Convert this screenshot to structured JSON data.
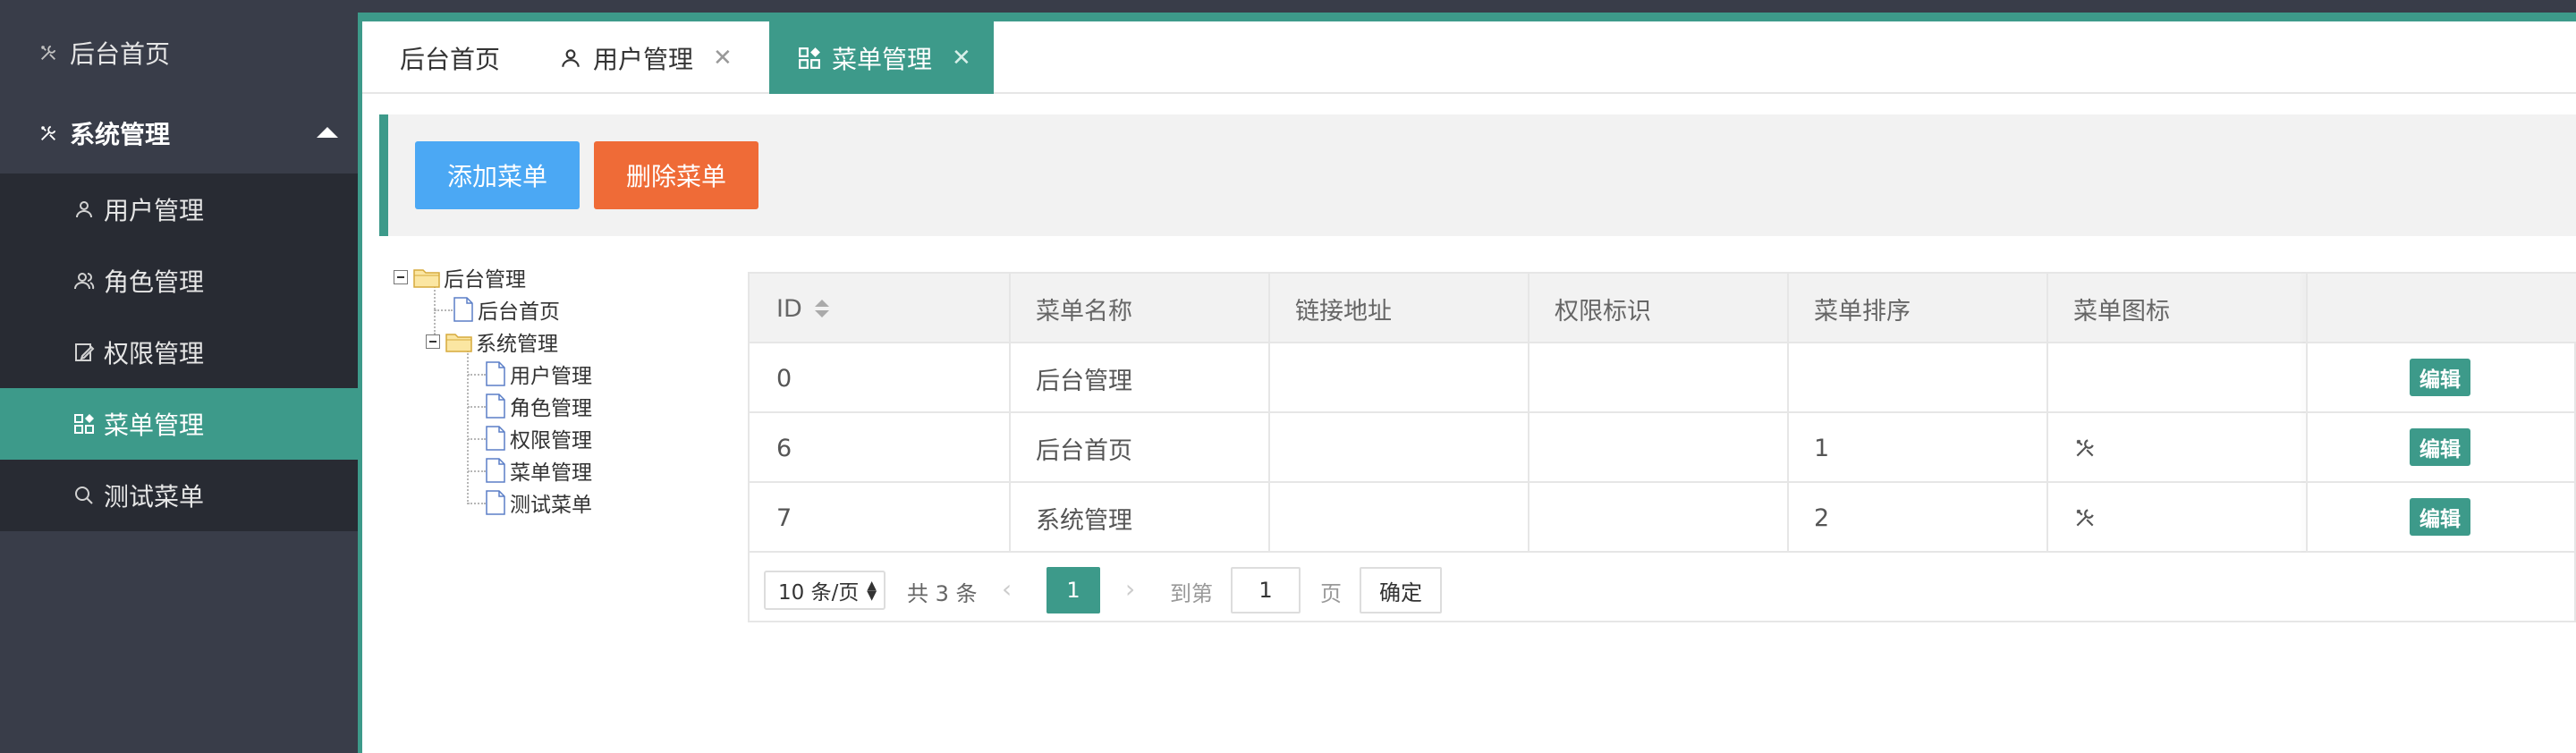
{
  "colors": {
    "accent": "#3d9a8a",
    "sidebar": "#393d49",
    "submenu": "#282b33",
    "add_button": "#4ba8f4",
    "delete_button": "#ef6b37"
  },
  "sidebar": {
    "home": {
      "label": "后台首页",
      "icon": "tools-icon"
    },
    "group": {
      "label": "系统管理",
      "icon": "tools-icon"
    },
    "items": [
      {
        "label": "用户管理",
        "icon": "user-icon"
      },
      {
        "label": "角色管理",
        "icon": "users-icon"
      },
      {
        "label": "权限管理",
        "icon": "edit-icon"
      },
      {
        "label": "菜单管理",
        "icon": "app-grid-icon",
        "active": true
      },
      {
        "label": "测试菜单",
        "icon": "search-icon"
      }
    ]
  },
  "tabs": [
    {
      "label": "后台首页"
    },
    {
      "label": "用户管理",
      "icon": "user-icon",
      "close": "✕"
    },
    {
      "label": "菜单管理",
      "icon": "app-grid-icon",
      "close": "✕",
      "active": true
    }
  ],
  "toolbar": {
    "add_label": "添加菜单",
    "delete_label": "删除菜单"
  },
  "tree": {
    "root": "后台管理",
    "home": "后台首页",
    "system": "系统管理",
    "children": [
      "用户管理",
      "角色管理",
      "权限管理",
      "菜单管理",
      "测试菜单"
    ]
  },
  "table": {
    "headers": [
      "ID",
      "菜单名称",
      "链接地址",
      "权限标识",
      "菜单排序",
      "菜单图标"
    ],
    "rows": [
      {
        "id": "0",
        "name": "后台管理",
        "url": "",
        "perm": "",
        "order": "",
        "icon": "",
        "action": "编辑"
      },
      {
        "id": "6",
        "name": "后台首页",
        "url": "",
        "perm": "",
        "order": "1",
        "icon": "tools-icon",
        "action": "编辑"
      },
      {
        "id": "7",
        "name": "系统管理",
        "url": "",
        "perm": "",
        "order": "2",
        "icon": "tools-icon",
        "action": "编辑"
      }
    ]
  },
  "pager": {
    "page_size": "10 条/页",
    "total": "共 3 条",
    "current": "1",
    "goto_label": "到第",
    "goto_value": "1",
    "page_label": "页",
    "confirm": "确定",
    "prev": "‹",
    "next": "›"
  }
}
